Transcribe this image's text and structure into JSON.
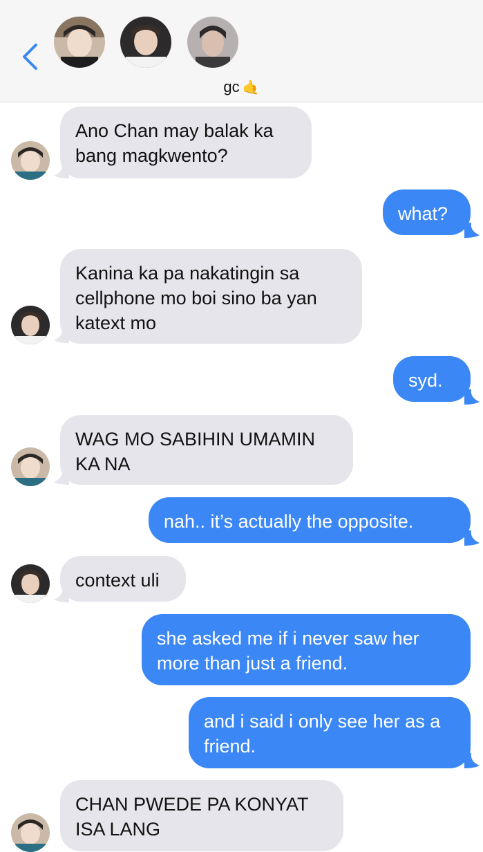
{
  "header": {
    "back_icon": "chevron-left-icon",
    "group_name": "gc",
    "group_emoji_icon": "call-me-hand-icon",
    "avatars": [
      "avatar-member-1",
      "avatar-member-2",
      "avatar-member-3"
    ]
  },
  "colors": {
    "incoming_bubble": "#e6e5eb",
    "outgoing_bubble": "#3b87f5",
    "accent": "#3b87f5"
  },
  "messages": [
    {
      "direction": "incoming",
      "sender": "member-1",
      "text": "Ano Chan may balak ka bang magkwento?"
    },
    {
      "direction": "outgoing",
      "text": "what?"
    },
    {
      "direction": "incoming",
      "sender": "member-2",
      "text": "Kanina ka pa nakatingin sa cellphone mo boi sino ba yan katext mo"
    },
    {
      "direction": "outgoing",
      "text": "syd."
    },
    {
      "direction": "incoming",
      "sender": "member-1",
      "text": "WAG MO SABIHIN UMAMIN KA NA"
    },
    {
      "direction": "outgoing",
      "text": "nah.. it’s actually the opposite."
    },
    {
      "direction": "incoming",
      "sender": "member-2",
      "text": "context uli"
    },
    {
      "direction": "outgoing",
      "text": "she asked me if i never saw her more than just a friend."
    },
    {
      "direction": "outgoing",
      "text": "and i said i only see her as a friend."
    },
    {
      "direction": "incoming",
      "sender": "member-1",
      "text": "CHAN PWEDE PA KONYAT ISA LANG"
    }
  ]
}
